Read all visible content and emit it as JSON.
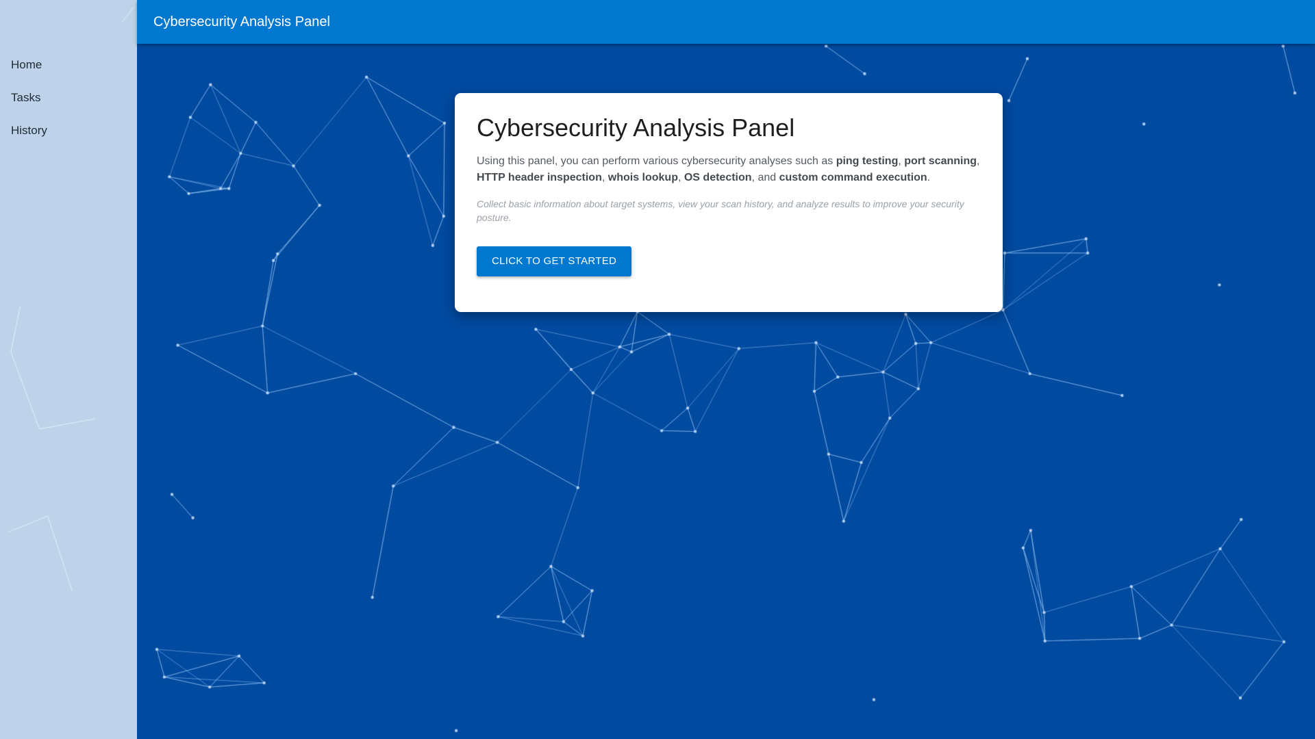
{
  "app": {
    "title": "Cybersecurity Analysis Panel"
  },
  "sidebar": {
    "items": [
      {
        "label": "Home"
      },
      {
        "label": "Tasks"
      },
      {
        "label": "History"
      }
    ]
  },
  "card": {
    "title": "Cybersecurity Analysis Panel",
    "desc": {
      "t0": "Using this panel, you can perform various cybersecurity analyses such as ",
      "b0": "ping testing",
      "t1": ", ",
      "b1": "port scanning",
      "t2": ", ",
      "b2": "HTTP header inspection",
      "t3": ", ",
      "b3": "whois lookup",
      "t4": ", ",
      "b4": "OS detection",
      "t5": ", and ",
      "b5": "custom command execution",
      "t6": "."
    },
    "note": "Collect basic information about target systems, view your scan history, and analyze results to improve your security posture.",
    "cta_label": "CLICK TO GET STARTED"
  },
  "colors": {
    "background": "#004aa0",
    "topbar": "#0078d0",
    "button": "#0078d0",
    "network_line": "#8fc0f0"
  }
}
